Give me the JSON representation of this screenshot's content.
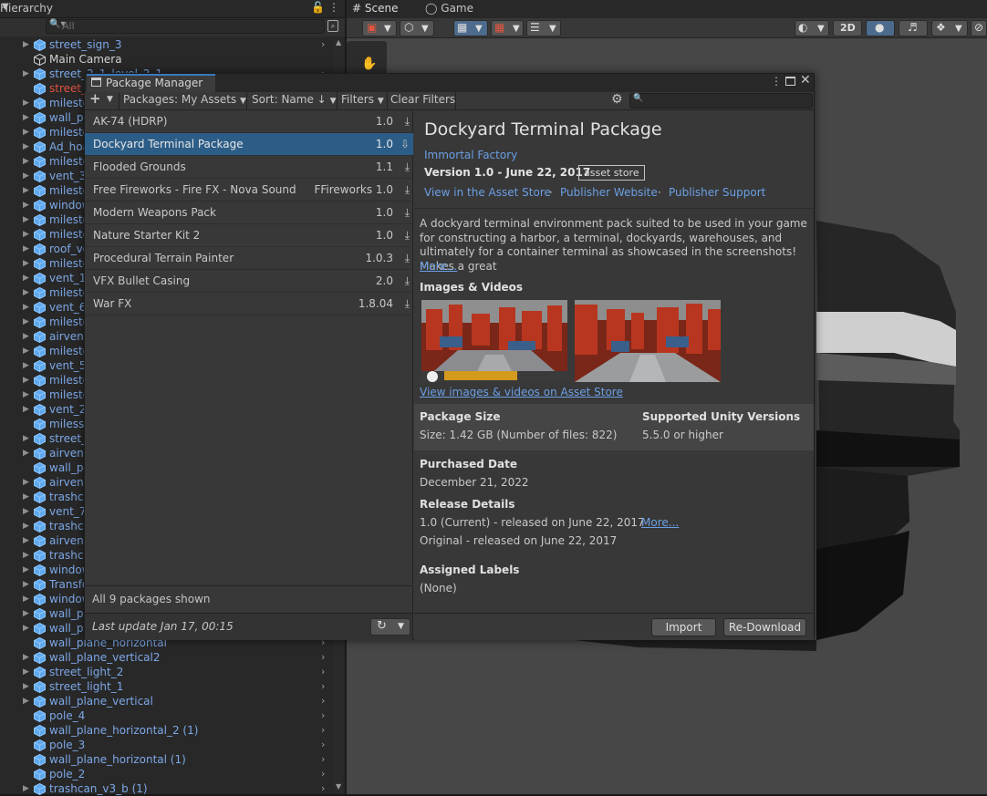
{
  "hierarchy": {
    "title": "Hierarchy",
    "search_placeholder": "All",
    "items": [
      {
        "label": "street_sign_3",
        "style": "blue",
        "arrow": true,
        "chevron": true
      },
      {
        "label": "Main Camera",
        "style": "white",
        "arrow": false,
        "chevron": false
      },
      {
        "label": "street_2_1_level_2_1",
        "style": "blue",
        "arrow": true,
        "chevron": true
      },
      {
        "label": "street_",
        "style": "red",
        "arrow": false,
        "chevron": false
      },
      {
        "label": "milesto",
        "style": "blue",
        "arrow": true,
        "chevron": false
      },
      {
        "label": "wall_pl",
        "style": "blue",
        "arrow": true,
        "chevron": false
      },
      {
        "label": "milesto",
        "style": "blue",
        "arrow": true,
        "chevron": false
      },
      {
        "label": "Ad_hoa",
        "style": "blue",
        "arrow": true,
        "chevron": false
      },
      {
        "label": "milesto",
        "style": "blue",
        "arrow": true,
        "chevron": false
      },
      {
        "label": "vent_3",
        "style": "blue",
        "arrow": true,
        "chevron": false
      },
      {
        "label": "milesto",
        "style": "blue",
        "arrow": true,
        "chevron": false
      },
      {
        "label": "window",
        "style": "blue",
        "arrow": true,
        "chevron": false
      },
      {
        "label": "milesto",
        "style": "blue",
        "arrow": true,
        "chevron": false
      },
      {
        "label": "milesto",
        "style": "blue",
        "arrow": true,
        "chevron": false
      },
      {
        "label": "roof_ve",
        "style": "blue",
        "arrow": true,
        "chevron": false
      },
      {
        "label": "milesto",
        "style": "blue",
        "arrow": true,
        "chevron": false
      },
      {
        "label": "vent_1",
        "style": "blue",
        "arrow": true,
        "chevron": false
      },
      {
        "label": "milesto",
        "style": "blue",
        "arrow": true,
        "chevron": false
      },
      {
        "label": "vent_6",
        "style": "blue",
        "arrow": true,
        "chevron": false
      },
      {
        "label": "milesto",
        "style": "blue",
        "arrow": true,
        "chevron": false
      },
      {
        "label": "airvent",
        "style": "blue",
        "arrow": true,
        "chevron": false
      },
      {
        "label": "milesto",
        "style": "blue",
        "arrow": true,
        "chevron": false
      },
      {
        "label": "vent_5",
        "style": "blue",
        "arrow": true,
        "chevron": false
      },
      {
        "label": "milesto",
        "style": "blue",
        "arrow": true,
        "chevron": false
      },
      {
        "label": "milesto",
        "style": "blue",
        "arrow": true,
        "chevron": false
      },
      {
        "label": "vent_2",
        "style": "blue",
        "arrow": true,
        "chevron": false
      },
      {
        "label": "milesst",
        "style": "blue",
        "arrow": false,
        "chevron": false
      },
      {
        "label": "street_",
        "style": "blue",
        "arrow": true,
        "chevron": false
      },
      {
        "label": "airvent",
        "style": "blue",
        "arrow": true,
        "chevron": false
      },
      {
        "label": "wall_pl",
        "style": "blue",
        "arrow": false,
        "chevron": false
      },
      {
        "label": "airvent",
        "style": "blue",
        "arrow": true,
        "chevron": false
      },
      {
        "label": "trashca",
        "style": "blue",
        "arrow": true,
        "chevron": false
      },
      {
        "label": "vent_7",
        "style": "blue",
        "arrow": true,
        "chevron": false
      },
      {
        "label": "trashca",
        "style": "blue",
        "arrow": true,
        "chevron": false
      },
      {
        "label": "airvent",
        "style": "blue",
        "arrow": true,
        "chevron": false
      },
      {
        "label": "trashca",
        "style": "blue",
        "arrow": true,
        "chevron": false
      },
      {
        "label": "window",
        "style": "blue",
        "arrow": true,
        "chevron": false
      },
      {
        "label": "Transfo",
        "style": "blue",
        "arrow": true,
        "chevron": false
      },
      {
        "label": "window",
        "style": "blue",
        "arrow": true,
        "chevron": false
      },
      {
        "label": "wall_pl",
        "style": "blue",
        "arrow": true,
        "chevron": false
      },
      {
        "label": "wall_pl",
        "style": "blue",
        "arrow": true,
        "chevron": false
      },
      {
        "label": "wall_plane_horizontal",
        "style": "blue",
        "arrow": false,
        "chevron": true
      },
      {
        "label": "wall_plane_vertical2",
        "style": "blue",
        "arrow": true,
        "chevron": true
      },
      {
        "label": "street_light_2",
        "style": "blue",
        "arrow": true,
        "chevron": true
      },
      {
        "label": "street_light_1",
        "style": "blue",
        "arrow": true,
        "chevron": true
      },
      {
        "label": "wall_plane_vertical",
        "style": "blue",
        "arrow": true,
        "chevron": true
      },
      {
        "label": "pole_4",
        "style": "blue",
        "arrow": false,
        "chevron": true
      },
      {
        "label": "wall_plane_horizontal_2 (1)",
        "style": "blue",
        "arrow": false,
        "chevron": true
      },
      {
        "label": "pole_3",
        "style": "blue",
        "arrow": false,
        "chevron": true
      },
      {
        "label": "wall_plane_horizontal (1)",
        "style": "blue",
        "arrow": false,
        "chevron": true
      },
      {
        "label": "pole_2",
        "style": "blue",
        "arrow": false,
        "chevron": true
      },
      {
        "label": "trashcan_v3_b (1)",
        "style": "blue",
        "arrow": true,
        "chevron": true
      }
    ]
  },
  "scene": {
    "scene_tab": "Scene",
    "game_tab": "Game",
    "two_d_label": "2D"
  },
  "pm": {
    "title": "Package Manager",
    "toolbar": {
      "add": "+",
      "packages": "Packages: My Assets",
      "sort": "Sort: Name ↓",
      "filters": "Filters",
      "clear": "Clear Filters"
    },
    "packages": [
      {
        "name": "AK-74 (HDRP)",
        "version": "1.0",
        "selected": false
      },
      {
        "name": "Dockyard Terminal Package",
        "version": "1.0",
        "selected": true
      },
      {
        "name": "Flooded Grounds",
        "version": "1.1",
        "selected": false
      },
      {
        "name": "Free Fireworks - Fire FX - Nova Sound",
        "version": "FFireworks 1.0",
        "selected": false
      },
      {
        "name": "Modern Weapons Pack",
        "version": "1.0",
        "selected": false
      },
      {
        "name": "Nature Starter Kit 2",
        "version": "1.0",
        "selected": false
      },
      {
        "name": "Procedural Terrain Painter",
        "version": "1.0.3",
        "selected": false
      },
      {
        "name": "VFX Bullet Casing",
        "version": "2.0",
        "selected": false
      },
      {
        "name": "War FX",
        "version": "1.8.04",
        "selected": false
      }
    ],
    "count_text": "All 9 packages shown",
    "last_update": "Last update Jan 17, 00:15",
    "detail": {
      "title": "Dockyard Terminal Package",
      "author": "Immortal Factory",
      "version": "Version 1.0 - June 22, 2017",
      "badge": "asset store",
      "links": [
        "View in the Asset Store",
        "Publisher Website",
        "Publisher Support"
      ],
      "description": "A dockyard terminal environment pack suited to be used in your game for constructing a harbor, a terminal, dockyards, warehouses, and ultimately for a container terminal as showcased in the screenshots! Makes a great",
      "more": "More...",
      "images_title": "Images & Videos",
      "images_link": "View images & videos on Asset Store",
      "size_title": "Package Size",
      "size_value": "Size: 1.42 GB (Number of files: 822)",
      "unity_title": "Supported Unity Versions",
      "unity_value": "5.5.0 or higher",
      "purchased_title": "Purchased Date",
      "purchased_value": "December 21, 2022",
      "release_title": "Release Details",
      "release_current": "1.0 (Current) - released on June 22, 2017",
      "release_more": "More...",
      "release_original": "Original - released on June 22, 2017",
      "labels_title": "Assigned Labels",
      "labels_value": "(None)"
    },
    "buttons": {
      "import": "Import",
      "redownload": "Re-Download"
    }
  }
}
